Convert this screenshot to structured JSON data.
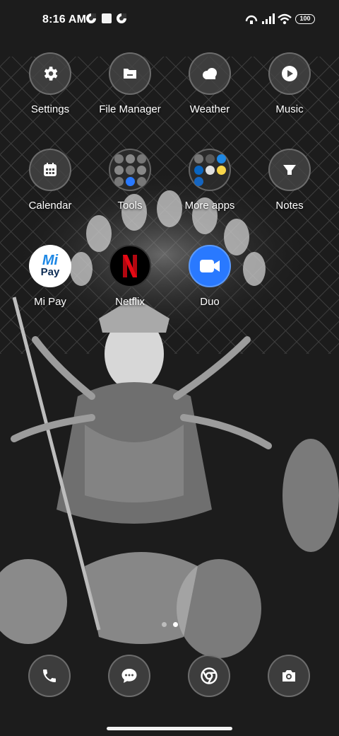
{
  "status_bar": {
    "time": "8:16 AM",
    "battery": "100"
  },
  "apps": {
    "settings": "Settings",
    "file_manager": "File Manager",
    "weather": "Weather",
    "music": "Music",
    "calendar": "Calendar",
    "tools": "Tools",
    "more_apps": "More apps",
    "notes": "Notes",
    "mi_pay": "Mi Pay",
    "netflix": "Netflix",
    "duo": "Duo"
  },
  "mi_pay_logo": {
    "top": "Mi",
    "bottom": "Pay"
  },
  "dock": [
    "phone-icon",
    "messages-icon",
    "chrome-icon",
    "camera-icon"
  ],
  "page_indicator": {
    "pages": 2,
    "current": 2
  },
  "colors": {
    "duo": "#2979ff",
    "netflix": "#e50914",
    "mi_pay": "#1565c0"
  }
}
